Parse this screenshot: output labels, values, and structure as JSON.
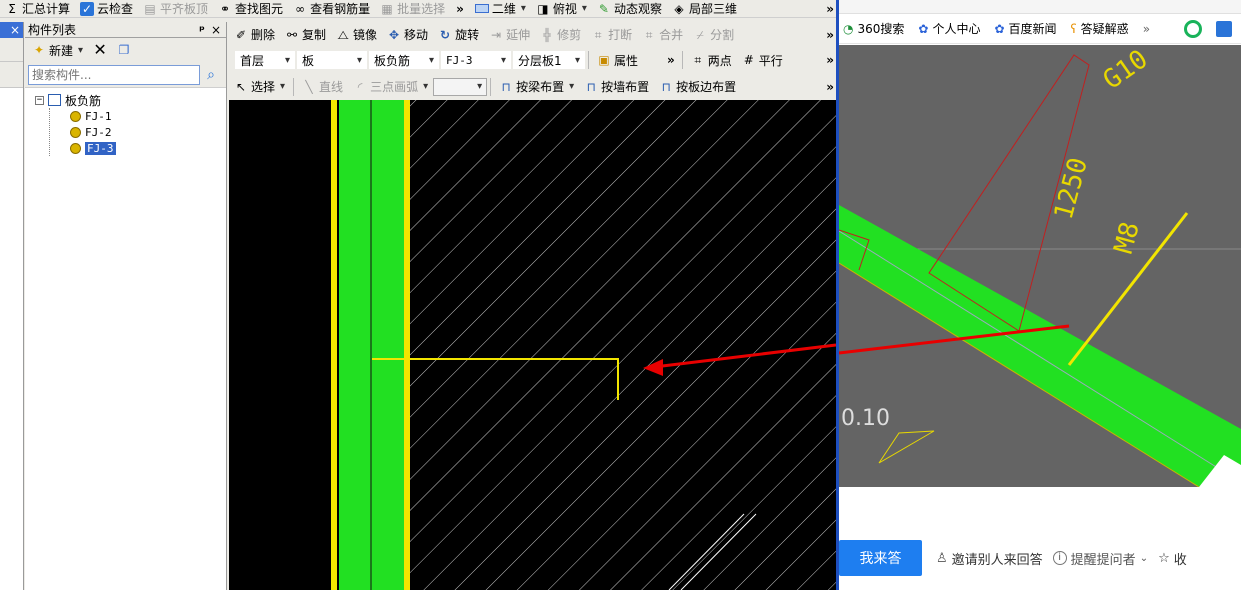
{
  "top_toolbar": {
    "summary": "汇总计算",
    "cloud_check": "云检查",
    "flush_board": "平齐板顶",
    "find_element": "查找图元",
    "view_rebar": "查看钢筋量",
    "batch_select": "批量选择",
    "view_2d": "二维",
    "view_top": "俯视",
    "dynamic_view": "动态观察",
    "local_3d": "局部三维",
    "more": "»"
  },
  "panel": {
    "title": "构件列表",
    "pin": "ᵖ",
    "close": "×",
    "new_label": "新建",
    "search_placeholder": "搜索构件...",
    "tree": {
      "root": "板负筋",
      "items": [
        {
          "label": "FJ-1"
        },
        {
          "label": "FJ-2"
        },
        {
          "label": "FJ-3"
        }
      ]
    }
  },
  "edit_toolbar": {
    "delete": "删除",
    "copy": "复制",
    "mirror": "镜像",
    "move": "移动",
    "rotate": "旋转",
    "extend": "延伸",
    "trim": "修剪",
    "break": "打断",
    "merge": "合并",
    "split": "分割",
    "more": "»"
  },
  "selector_toolbar": {
    "floor": "首层",
    "type": "板",
    "category": "板负筋",
    "element": "FJ-3",
    "layer": "分层板1",
    "properties": "属性",
    "two_points": "两点",
    "parallel": "平行",
    "more": "»"
  },
  "draw_toolbar": {
    "select": "选择",
    "line": "直线",
    "arc": "三点画弧",
    "by_beam": "按梁布置",
    "by_wall": "按墙布置",
    "by_slab_edge": "按板边布置",
    "more": "»"
  },
  "browser": {
    "bookmarks": [
      "360搜索",
      "个人中心",
      "百度新闻",
      "答疑解惑"
    ],
    "more": "»",
    "cad_labels": {
      "g10": "G10",
      "dim1250": "1250",
      "m8": "M8",
      "val": "0.10"
    },
    "answer_button": "我来答",
    "invite": "邀请别人来回答",
    "remind": "提醒提问者",
    "collect": "收"
  },
  "colors": {
    "toolbar_bg": "#ecebe6",
    "cad_bg": "#000000",
    "rebar_green": "#22e022",
    "rebar_yellow": "#f2e500",
    "browser_cad_bg": "#646464",
    "accent_blue": "#1e7ef0",
    "selection_blue": "#3163c5"
  }
}
